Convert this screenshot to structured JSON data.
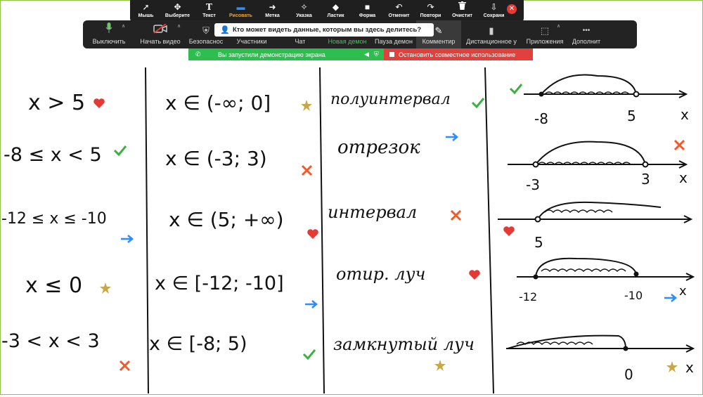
{
  "annotate_toolbar": {
    "tools": [
      {
        "label": "Мышь",
        "icon": "mouse-pointer-icon",
        "glyph": "➚"
      },
      {
        "label": "Выберите",
        "icon": "move-icon",
        "glyph": "✥"
      },
      {
        "label": "Текст",
        "icon": "text-icon",
        "glyph": "T"
      },
      {
        "label": "Рисовать",
        "icon": "pen-icon",
        "glyph": "▬"
      },
      {
        "label": "Метка",
        "icon": "arrow-icon",
        "glyph": "➜"
      },
      {
        "label": "Указка",
        "icon": "spotlight-icon",
        "glyph": "✧"
      },
      {
        "label": "Ластик",
        "icon": "eraser-icon",
        "glyph": "◆"
      },
      {
        "label": "Форма",
        "icon": "shape-icon",
        "glyph": "■"
      },
      {
        "label": "Отменит",
        "icon": "undo-icon",
        "glyph": "↶"
      },
      {
        "label": "Повтори",
        "icon": "redo-icon",
        "glyph": "↷"
      },
      {
        "label": "Очистит",
        "icon": "trash-icon",
        "glyph": "🗑"
      },
      {
        "label": "Сохрани",
        "icon": "save-icon",
        "glyph": "⇩"
      }
    ],
    "active_tool": "Рисовать",
    "close_glyph": "✕"
  },
  "controls": {
    "items": [
      {
        "label": "Выключить",
        "icon": "microphone-icon",
        "glyph": "🎙"
      },
      {
        "label": "Начать видео",
        "icon": "video-off-icon",
        "glyph": "▇"
      },
      {
        "label": "Безопаснос",
        "icon": "shield-icon",
        "glyph": "⛨"
      },
      {
        "label": "Участники",
        "icon": "participants-icon",
        "glyph": " "
      },
      {
        "label": "Чат",
        "icon": "chat-icon",
        "glyph": " "
      },
      {
        "label": "Новая демон",
        "icon": "new-share-icon",
        "glyph": " "
      },
      {
        "label": "Пауза демон",
        "icon": "pause-share-icon",
        "glyph": " "
      },
      {
        "label": "Комментир",
        "icon": "annotate-icon",
        "glyph": "✎"
      },
      {
        "label": "Дистанционное у",
        "icon": "remote-control-icon",
        "glyph": "▮"
      },
      {
        "label": "Приложения",
        "icon": "apps-icon",
        "glyph": "⬚"
      },
      {
        "label": "Дополнит",
        "icon": "more-icon",
        "glyph": "•••"
      }
    ],
    "tooltip": "Кто может видеть данные, которым вы здесь делитесь?"
  },
  "share_bar": {
    "message": "Вы запустили демонстрацию экрана",
    "stop_label": "Остановить совместное использование",
    "green": "#2ebd4f",
    "red": "#e0413d"
  },
  "board": {
    "col1": [
      "x > 5",
      "-8 ≤ x < 5",
      "-12 ≤ x ≤ -10",
      "x ≤ 0",
      "-3 < x < 3"
    ],
    "col2": [
      "x ∈ (-∞; 0]",
      "x ∈ (-3; 3)",
      "x ∈ (5; +∞)",
      "x ∈ [-12; -10]",
      "x ∈ [-8; 5)"
    ],
    "col3": [
      "полуинтервал",
      "отрезок",
      "интервал",
      "отир. луч",
      "замкнутый луч"
    ],
    "col4_labels": {
      "r1_left": "-8",
      "r1_right": "5",
      "r1_x": "x",
      "r2_left": "-3",
      "r2_right": "3",
      "r2_x": "x",
      "r3_left": "5",
      "r4_left": "-12",
      "r4_right": "-10",
      "r4_x": "x",
      "r5_right": "0"
    },
    "marks_legend": {
      "heart": "#e53935",
      "check": "#3cb043",
      "star": "#c9a646",
      "arrow": "#2d8cff",
      "cross": "#f05a2a"
    }
  }
}
